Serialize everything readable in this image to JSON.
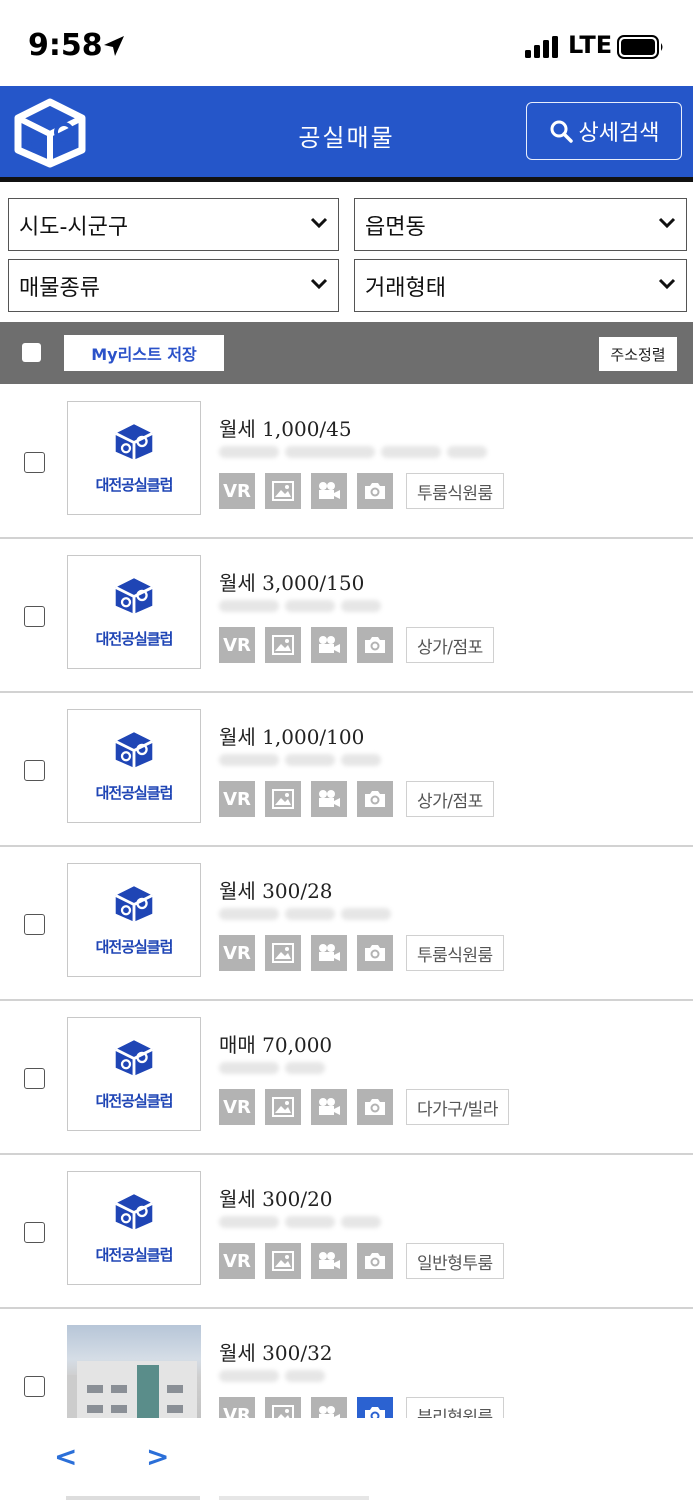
{
  "status_bar": {
    "time": "9:58",
    "network": "LTE"
  },
  "header": {
    "title": "공실매물",
    "search_label": "상세검색"
  },
  "filters": [
    {
      "id": "region",
      "label": "시도-시군구"
    },
    {
      "id": "town",
      "label": "읍면동"
    },
    {
      "id": "property_type",
      "label": "매물종류"
    },
    {
      "id": "deal_type",
      "label": "거래형태"
    }
  ],
  "listbar": {
    "mylist_label": "My리스트 저장",
    "sort_label": "주소정렬"
  },
  "logo_text": "대전공실클럽",
  "listings": [
    {
      "price": "월세  1,000/45",
      "type": "투룸식원룸",
      "photo_on": false
    },
    {
      "price": "월세  3,000/150",
      "type": "상가/점포",
      "photo_on": false
    },
    {
      "price": "월세  1,000/100",
      "type": "상가/점포",
      "photo_on": false
    },
    {
      "price": "월세  300/28",
      "type": "투룸식원룸",
      "photo_on": false
    },
    {
      "price": "매매  70,000",
      "type": "다가구/빌라",
      "photo_on": false
    },
    {
      "price": "월세  300/20",
      "type": "일반형투룸",
      "photo_on": false
    },
    {
      "price": "월세  300/32",
      "type": "분리형원룸",
      "photo_on": true
    }
  ],
  "icon_labels": {
    "vr": "VR"
  },
  "pager": {
    "prev": "<",
    "next": ">"
  },
  "colors": {
    "brand_blue": "#2556c9",
    "icon_gray": "#b3b3b3",
    "icon_active": "#2b62d1"
  }
}
